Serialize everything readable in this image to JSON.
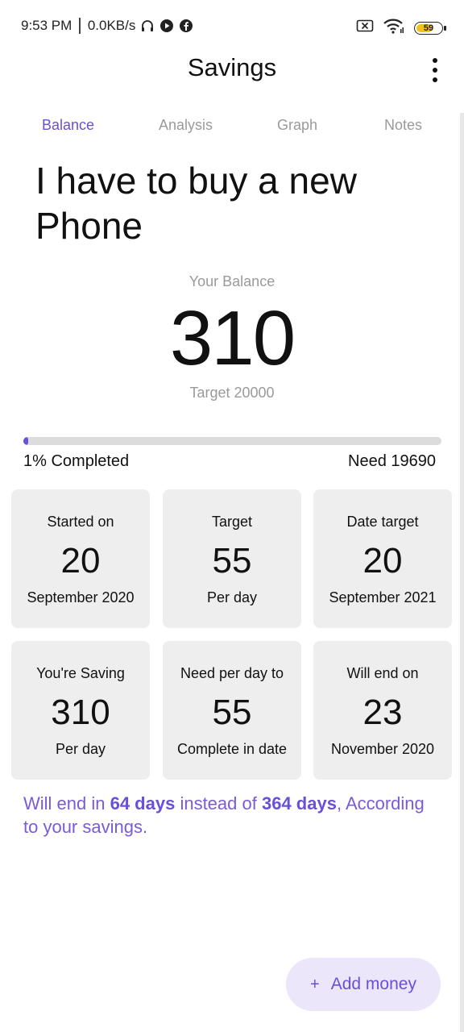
{
  "status_bar": {
    "time": "9:53 PM",
    "net_speed": "0.0KB/s",
    "battery": "59"
  },
  "app_bar": {
    "title": "Savings"
  },
  "tabs": [
    {
      "label": "Balance",
      "active": true
    },
    {
      "label": "Analysis",
      "active": false
    },
    {
      "label": "Graph",
      "active": false
    },
    {
      "label": "Notes",
      "active": false
    }
  ],
  "goal": {
    "title": "I have to buy a new Phone"
  },
  "balance": {
    "label": "Your Balance",
    "value": "310",
    "target_text": "Target 20000"
  },
  "progress": {
    "percent": 1,
    "completed_text": "1% Completed",
    "need_text": "Need 19690"
  },
  "cards": [
    {
      "top": "Started on",
      "big": "20",
      "bottom": "September 2020"
    },
    {
      "top": "Target",
      "big": "55",
      "bottom": "Per day"
    },
    {
      "top": "Date target",
      "big": "20",
      "bottom": "September 2021"
    },
    {
      "top": "You're Saving",
      "big": "310",
      "bottom": "Per day"
    },
    {
      "top": "Need per day to",
      "big": "55",
      "bottom": "Complete in date"
    },
    {
      "top": "Will end on",
      "big": "23",
      "bottom": "November 2020"
    }
  ],
  "summary": {
    "prefix": "Will end in ",
    "days_actual": "64 days",
    "middle": " instead of ",
    "days_target": "364 days",
    "suffix": ", According to your savings."
  },
  "fab": {
    "icon": "+",
    "label": "Add money"
  },
  "colors": {
    "accent": "#6a4fd8",
    "summary_text": "#7b5ad6",
    "card_bg": "#eeeeee",
    "fab_bg": "#ece6fb"
  }
}
